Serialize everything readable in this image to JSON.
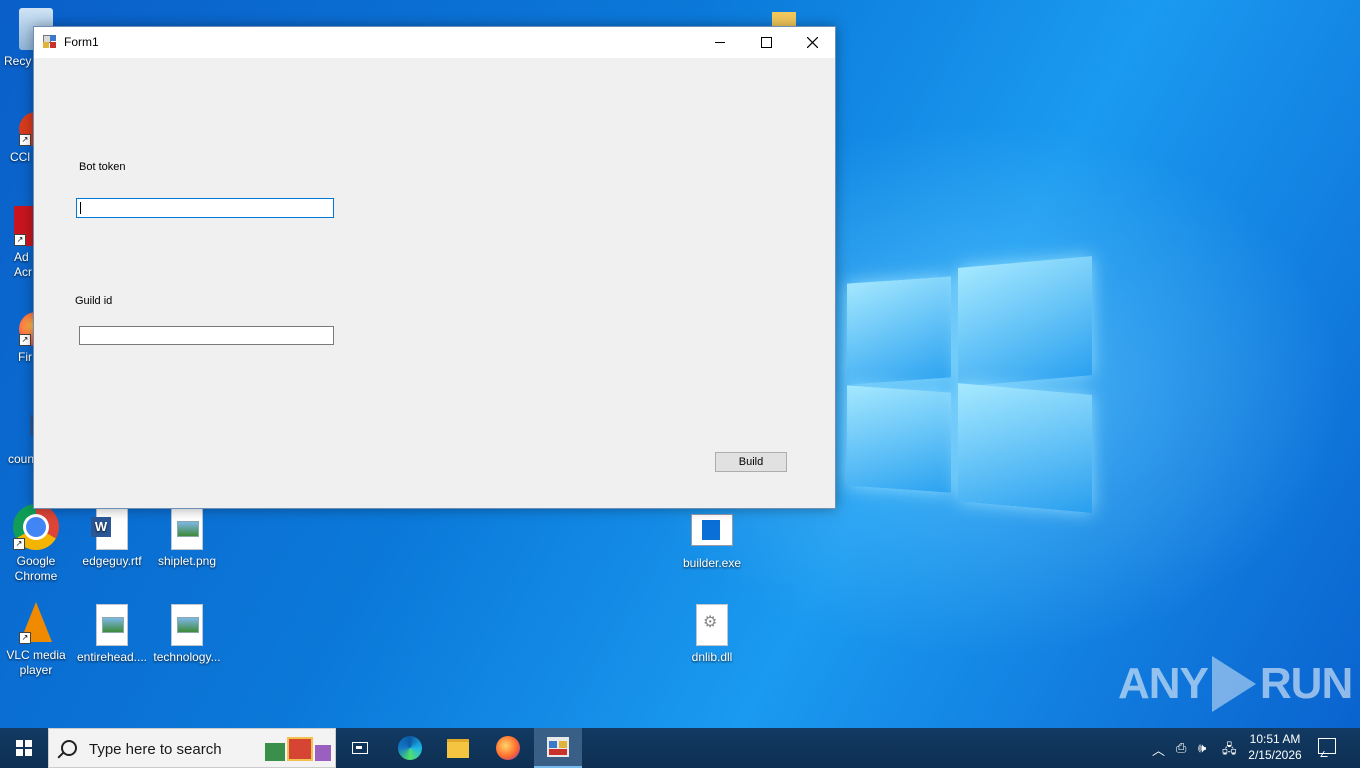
{
  "desktop": {
    "icons": [
      {
        "label": "Recy",
        "icon": "recycle-bin-icon"
      },
      {
        "label": "CCl",
        "icon": "ccleaner-icon"
      },
      {
        "label": "Ad Acr",
        "icon": "acrobat-icon"
      },
      {
        "label": "Fir",
        "icon": "firefox-icon"
      },
      {
        "label": "coun",
        "icon": "word-doc-icon"
      },
      {
        "label": "Google Chrome",
        "icon": "chrome-icon"
      },
      {
        "label": "edgeguy.rtf",
        "icon": "word-doc-icon"
      },
      {
        "label": "shiplet.png",
        "icon": "image-file-icon"
      },
      {
        "label": "builder.exe",
        "icon": "exe-icon"
      },
      {
        "label": "VLC media player",
        "icon": "vlc-icon"
      },
      {
        "label": "entirehead....",
        "icon": "image-file-icon"
      },
      {
        "label": "technology...",
        "icon": "image-file-icon"
      },
      {
        "label": "dnlib.dll",
        "icon": "dll-gear-icon"
      }
    ]
  },
  "window": {
    "title": "Form1",
    "controls": {
      "minimize": "—",
      "maximize": "☐",
      "close": "✕"
    },
    "bot_token_label": "Bot token",
    "bot_token_value": "",
    "guild_id_label": "Guild id",
    "guild_id_value": "",
    "build_button": "Build"
  },
  "watermark": {
    "left": "ANY",
    "right": "RUN"
  },
  "taskbar": {
    "search_placeholder": "Type here to search",
    "apps": [
      "task-view",
      "edge",
      "file-explorer",
      "firefox",
      "form1"
    ],
    "time": "10:51 AM",
    "date": "2/15/2026"
  }
}
